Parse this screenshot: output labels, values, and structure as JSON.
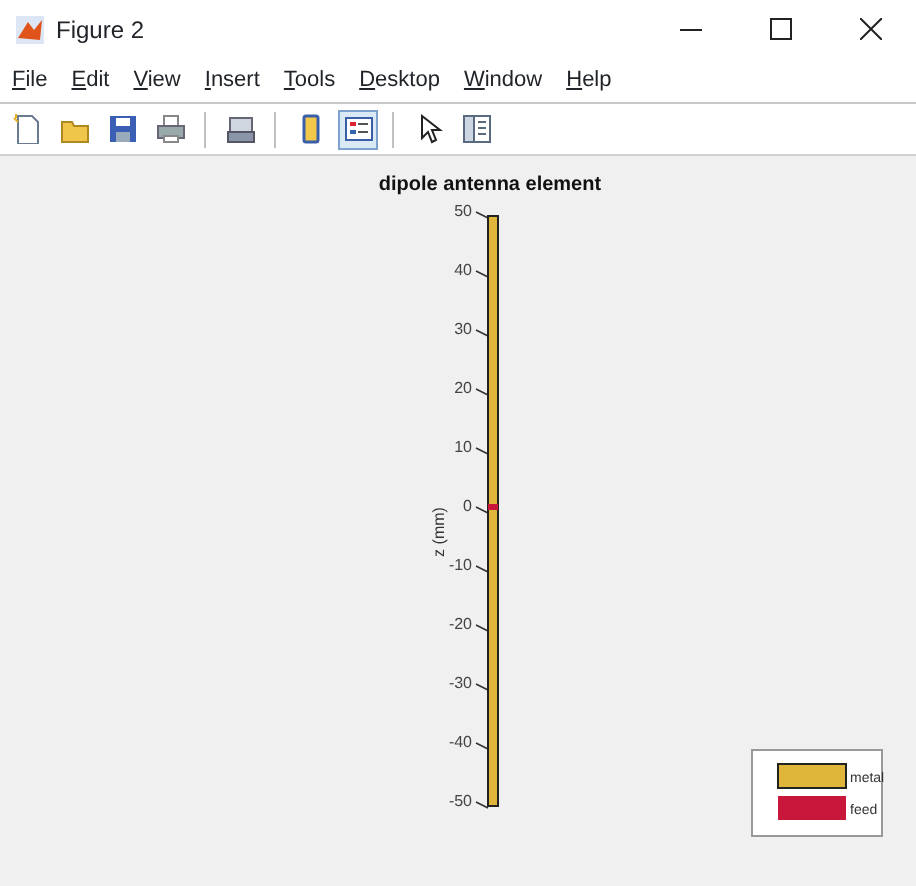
{
  "window": {
    "title": "Figure 2"
  },
  "menu": [
    "File",
    "Edit",
    "View",
    "Insert",
    "Tools",
    "Desktop",
    "Window",
    "Help"
  ],
  "toolbar": [
    {
      "kind": "new",
      "pressed": false
    },
    {
      "kind": "open",
      "pressed": false
    },
    {
      "kind": "save",
      "pressed": false
    },
    {
      "kind": "print",
      "pressed": false
    },
    {
      "kind": "sep"
    },
    {
      "kind": "link",
      "pressed": false
    },
    {
      "kind": "sep"
    },
    {
      "kind": "colorbar",
      "pressed": false
    },
    {
      "kind": "legend",
      "pressed": true
    },
    {
      "kind": "sep"
    },
    {
      "kind": "pointer",
      "pressed": false
    },
    {
      "kind": "panel",
      "pressed": false
    }
  ],
  "plot": {
    "title": "dipole antenna element",
    "ylabel": "z (mm)",
    "ticks": [
      "50",
      "40",
      "30",
      "20",
      "10",
      "0",
      "-10",
      "-20",
      "-30",
      "-40",
      "-50"
    ]
  },
  "legend": [
    {
      "label": "metal",
      "color": "#e0b63a"
    },
    {
      "label": "feed",
      "color": "#c8173a"
    }
  ]
}
